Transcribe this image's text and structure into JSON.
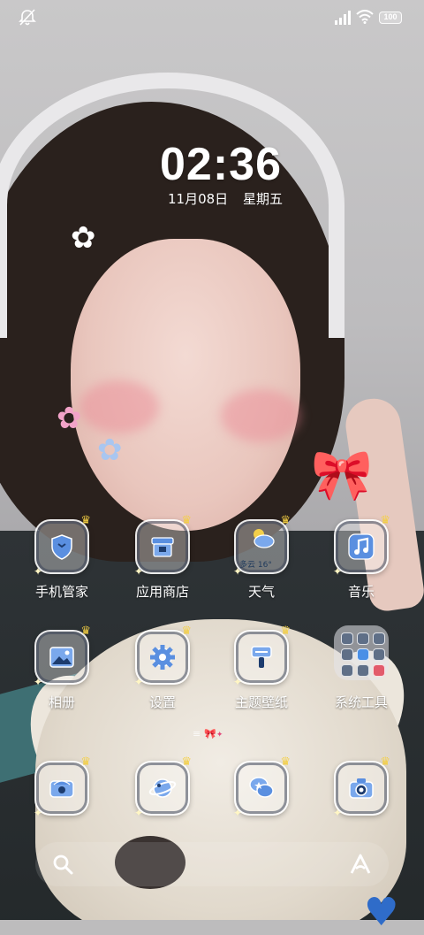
{
  "status_bar": {
    "mute_icon": "notifications-muted-icon",
    "signal_icon": "cellular-signal-icon",
    "wifi_icon": "wifi-icon",
    "battery_level": "100"
  },
  "clock": {
    "time": "02:36",
    "date": "11月08日",
    "weekday": "星期五"
  },
  "apps": [
    {
      "label": "手机管家",
      "icon": "shield-icon"
    },
    {
      "label": "应用商店",
      "icon": "store-icon"
    },
    {
      "label": "天气",
      "icon": "weather-icon",
      "weather_text": "多云 16°"
    },
    {
      "label": "音乐",
      "icon": "music-icon"
    },
    {
      "label": "相册",
      "icon": "gallery-icon"
    },
    {
      "label": "设置",
      "icon": "gear-icon"
    },
    {
      "label": "主题壁纸",
      "icon": "paintbrush-icon"
    },
    {
      "label": "系统工具",
      "icon": "folder-icon"
    }
  ],
  "dock": [
    {
      "icon": "phone-icon"
    },
    {
      "icon": "browser-planet-icon"
    },
    {
      "icon": "messages-icon"
    },
    {
      "icon": "camera-icon"
    }
  ],
  "search": {
    "search_icon": "search-icon",
    "assistant_icon": "assistant-icon"
  },
  "colors": {
    "icon_blue": "#5a8fe0",
    "crown": "#f4cf43",
    "page_indicator": "#e3487a"
  }
}
